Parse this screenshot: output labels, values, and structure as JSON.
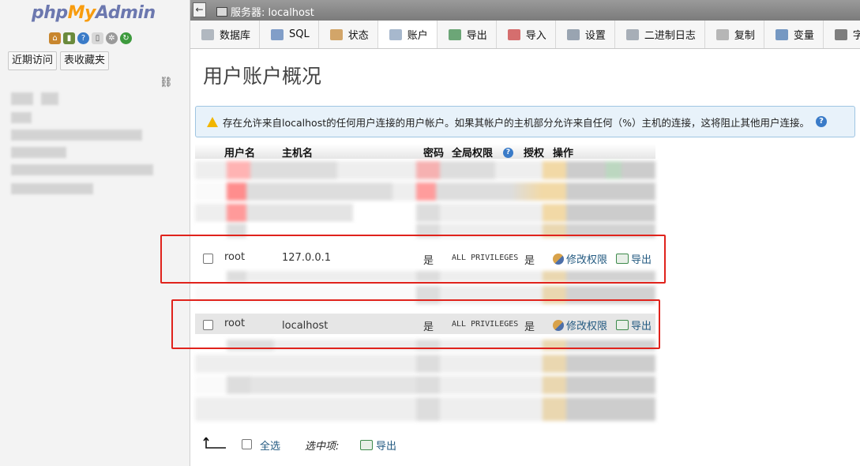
{
  "nav": {
    "logo_php": "php",
    "logo_my": "My",
    "logo_admin": "Admin",
    "icons": [
      "home-icon",
      "exit-icon",
      "help-icon",
      "docs-icon",
      "settings-icon",
      "reload-icon"
    ],
    "recent_button": "近期访问",
    "favorites_button": "表收藏夹"
  },
  "topbar": {
    "collapse": "←",
    "server_label": "服务器: localhost"
  },
  "tabs": [
    {
      "label": "数据库",
      "icon": "database-icon",
      "color": "#9aa3ad"
    },
    {
      "label": "SQL",
      "icon": "sql-icon",
      "color": "#5a80b8"
    },
    {
      "label": "状态",
      "icon": "status-icon",
      "color": "#c58a3a"
    },
    {
      "label": "账户",
      "icon": "users-icon",
      "color": "#8aa0bc"
    },
    {
      "label": "导出",
      "icon": "export-icon",
      "color": "#3e8b4c"
    },
    {
      "label": "导入",
      "icon": "import-icon",
      "color": "#c94040"
    },
    {
      "label": "设置",
      "icon": "wrench-icon",
      "color": "#7a8899"
    },
    {
      "label": "二进制日志",
      "icon": "binlog-icon",
      "color": "#8c96a2"
    },
    {
      "label": "复制",
      "icon": "replication-icon",
      "color": "#a0a0a0"
    },
    {
      "label": "变量",
      "icon": "variables-icon",
      "color": "#4a78b0"
    },
    {
      "label": "字",
      "icon": "charset-icon",
      "color": "#555555"
    }
  ],
  "active_tab": "账户",
  "page_title": "用户账户概况",
  "notice": "存在允许来自localhost的任何用户连接的用户帐户。如果其帐户的主机部分允许来自任何（%）主机的连接，这将阻止其他用户连接。",
  "table": {
    "headers": {
      "user": "用户名",
      "host": "主机名",
      "password": "密码",
      "global_privileges": "全局权限",
      "grant": "授权",
      "action": "操作"
    },
    "rows": [
      {
        "user": "root",
        "host": "127.0.0.1",
        "password": "是",
        "privileges": "ALL PRIVILEGES",
        "grant": "是",
        "edit": "修改权限",
        "export": "导出"
      },
      {
        "user": "root",
        "host": "localhost",
        "password": "是",
        "privileges": "ALL PRIVILEGES",
        "grant": "是",
        "edit": "修改权限",
        "export": "导出"
      }
    ]
  },
  "bottom": {
    "select_all": "全选",
    "with_selected": "选中项:",
    "export": "导出"
  },
  "colors": {
    "link": "#235a81",
    "highlight": "#e0231c",
    "notice_bg": "#e8f2fa"
  }
}
